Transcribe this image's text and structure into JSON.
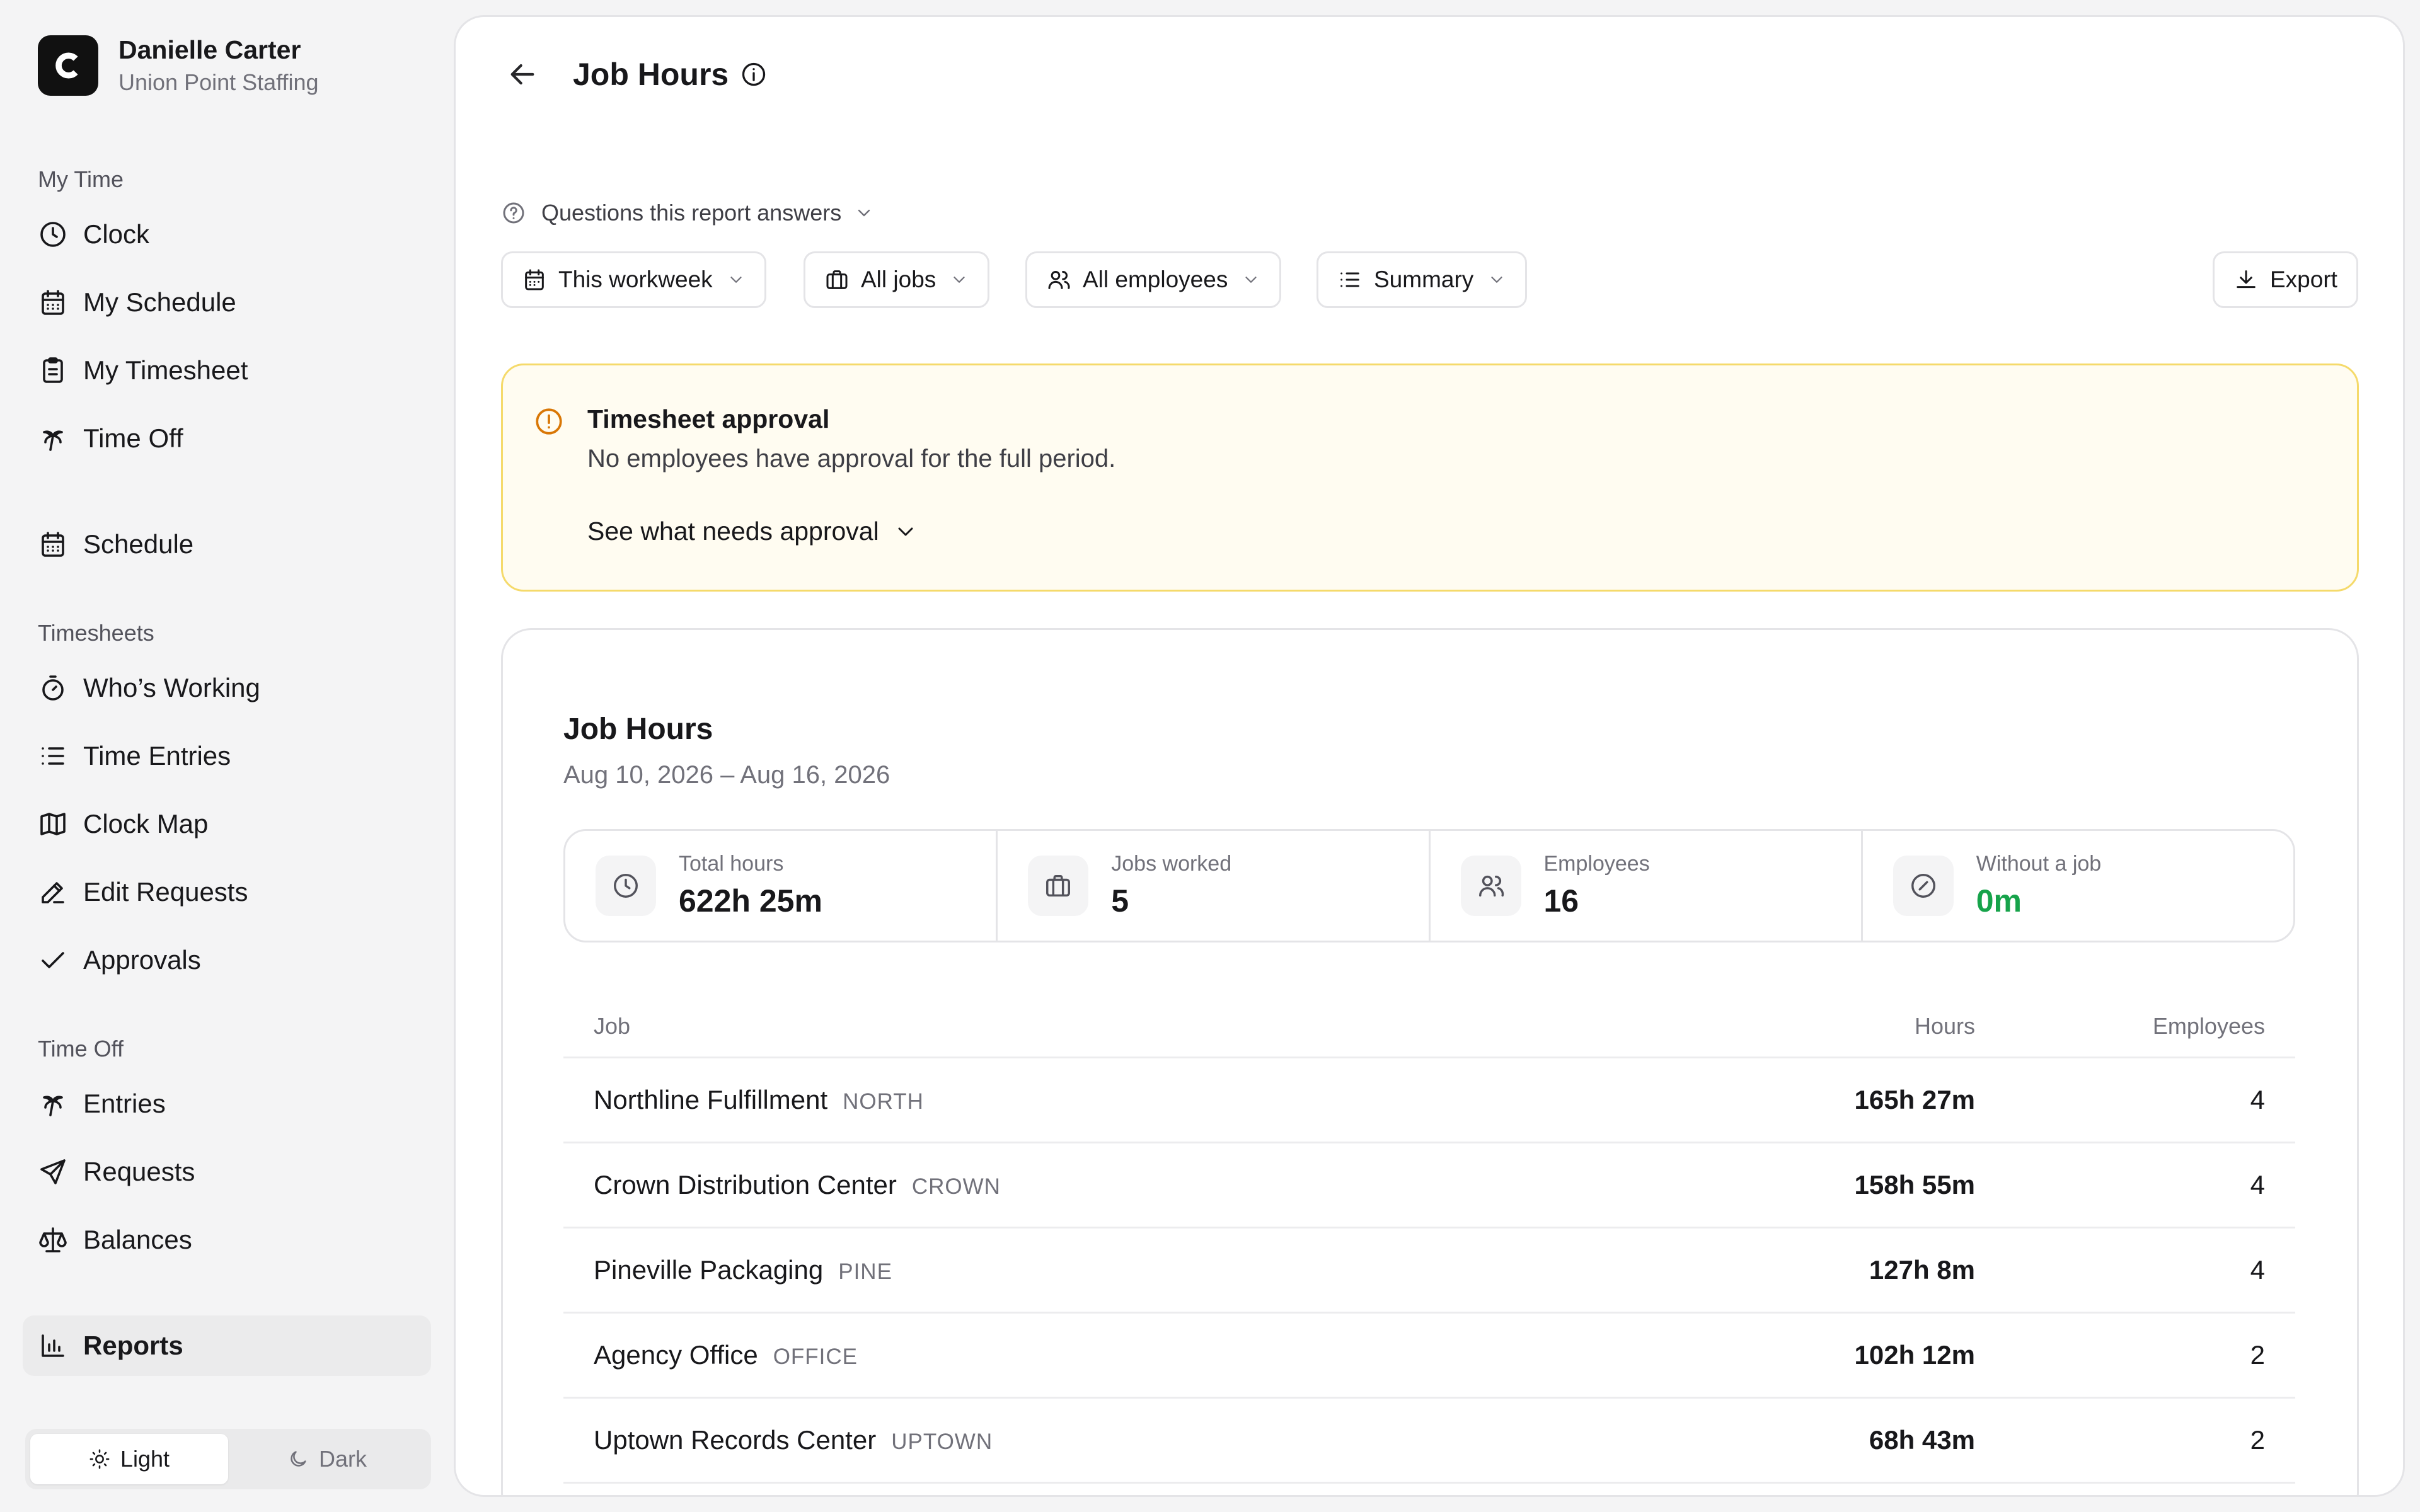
{
  "profile": {
    "name": "Danielle Carter",
    "org": "Union Point Staffing"
  },
  "sidebar": {
    "sections": {
      "my_time": "My Time",
      "timesheets": "Timesheets",
      "time_off": "Time Off"
    },
    "items": [
      {
        "label": "Clock",
        "icon": "clock-icon"
      },
      {
        "label": "My Schedule",
        "icon": "calendar-icon"
      },
      {
        "label": "My Timesheet",
        "icon": "clipboard-icon"
      },
      {
        "label": "Time Off",
        "icon": "palm-tree-icon"
      },
      {
        "label": "Schedule",
        "icon": "calendar-icon"
      },
      {
        "label": "Who’s Working",
        "icon": "stopwatch-icon"
      },
      {
        "label": "Time Entries",
        "icon": "list-icon"
      },
      {
        "label": "Clock Map",
        "icon": "map-icon"
      },
      {
        "label": "Edit Requests",
        "icon": "pencil-icon"
      },
      {
        "label": "Approvals",
        "icon": "check-icon"
      },
      {
        "label": "Entries",
        "icon": "palm-tree-icon"
      },
      {
        "label": "Requests",
        "icon": "send-icon"
      },
      {
        "label": "Balances",
        "icon": "scale-icon"
      },
      {
        "label": "Reports",
        "icon": "bar-chart-icon"
      }
    ],
    "active_item": "Reports",
    "theme": {
      "light": "Light",
      "dark": "Dark",
      "selected": "Light"
    }
  },
  "header": {
    "title": "Job Hours"
  },
  "questions": {
    "label": "Questions this report answers"
  },
  "filters": {
    "period": "This workweek",
    "jobs": "All jobs",
    "employees": "All employees",
    "view": "Summary",
    "export": "Export"
  },
  "alert": {
    "title": "Timesheet approval",
    "body": "No employees have approval for the full period.",
    "link": "See what needs approval",
    "color": "#d97706"
  },
  "report": {
    "title": "Job Hours",
    "date_range": "Aug 10, 2026 – Aug 16, 2026",
    "stats": [
      {
        "label": "Total hours",
        "value": "622h 25m",
        "icon": "clock-icon"
      },
      {
        "label": "Jobs worked",
        "value": "5",
        "icon": "briefcase-icon"
      },
      {
        "label": "Employees",
        "value": "16",
        "icon": "users-icon"
      },
      {
        "label": "Without a job",
        "value": "0m",
        "icon": "slash-circle-icon",
        "color": "#16a34a"
      }
    ],
    "columns": {
      "job": "Job",
      "hours": "Hours",
      "employees": "Employees"
    },
    "rows": [
      {
        "job": "Northline Fulfillment",
        "code": "NORTH",
        "hours": "165h 27m",
        "employees": "4"
      },
      {
        "job": "Crown Distribution Center",
        "code": "CROWN",
        "hours": "158h 55m",
        "employees": "4"
      },
      {
        "job": "Pineville Packaging",
        "code": "PINE",
        "hours": "127h 8m",
        "employees": "4"
      },
      {
        "job": "Agency Office",
        "code": "OFFICE",
        "hours": "102h 12m",
        "employees": "2"
      },
      {
        "job": "Uptown Records Center",
        "code": "UPTOWN",
        "hours": "68h 43m",
        "employees": "2"
      }
    ]
  }
}
